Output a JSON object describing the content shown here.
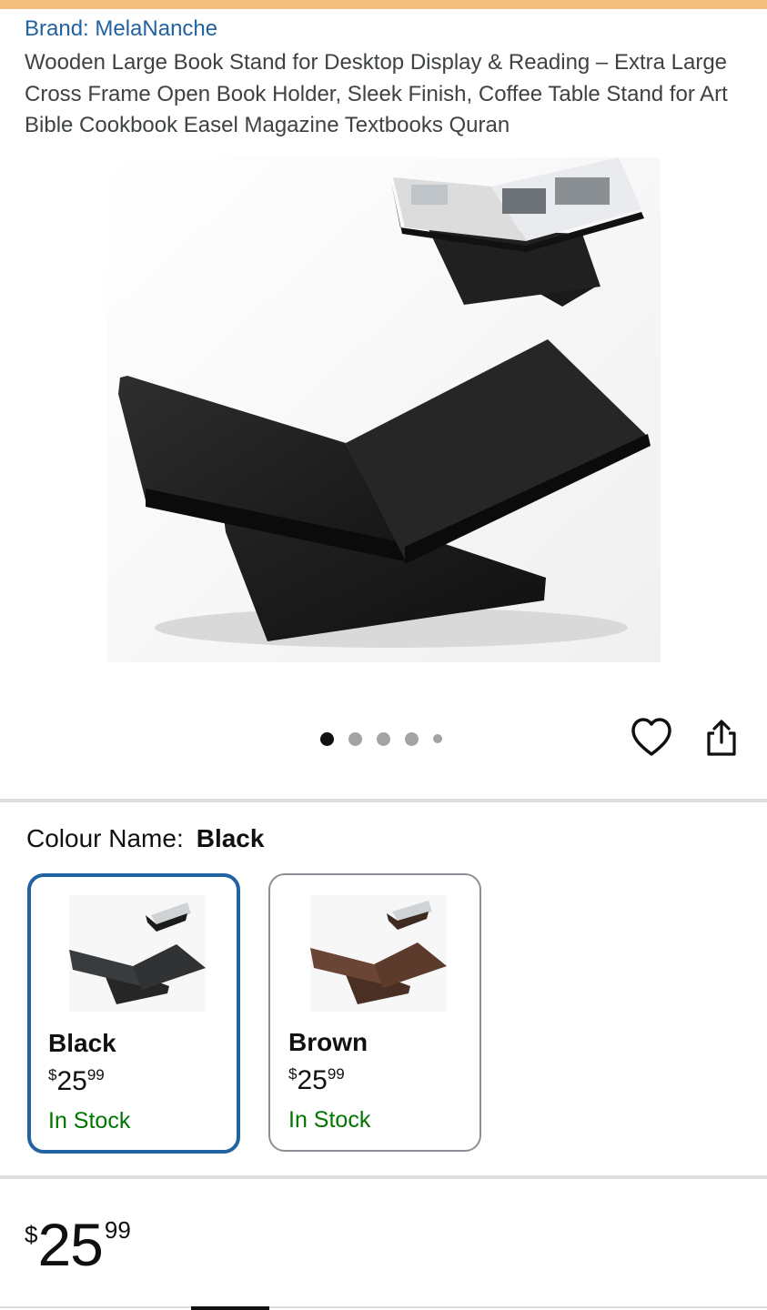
{
  "product": {
    "brand_link": "Brand: MelaNanche",
    "title": "Wooden Large Book Stand for Desktop Display & Reading – Extra Large Cross Frame Open Book Holder, Sleek Finish, Coffee Table Stand for Art Bible Cookbook Easel Magazine Textbooks Quran"
  },
  "gallery": {
    "image_count": 5,
    "active_index": 0,
    "wishlist_icon": "heart-outline-icon",
    "share_icon": "share-icon"
  },
  "variation": {
    "label": "Colour Name:",
    "selected": "Black",
    "options": [
      {
        "name": "Black",
        "currency": "$",
        "whole": "25",
        "fraction": "99",
        "stock": "In Stock",
        "color": "#2b2b2b",
        "selected": true
      },
      {
        "name": "Brown",
        "currency": "$",
        "whole": "25",
        "fraction": "99",
        "stock": "In Stock",
        "color": "#5a3a2c",
        "selected": false
      }
    ]
  },
  "price": {
    "currency": "$",
    "whole": "25",
    "fraction": "99"
  },
  "colors": {
    "link": "#2162a1",
    "stock": "#007600",
    "stripe": "#f3c07e",
    "selected_border": "#2162a1"
  }
}
